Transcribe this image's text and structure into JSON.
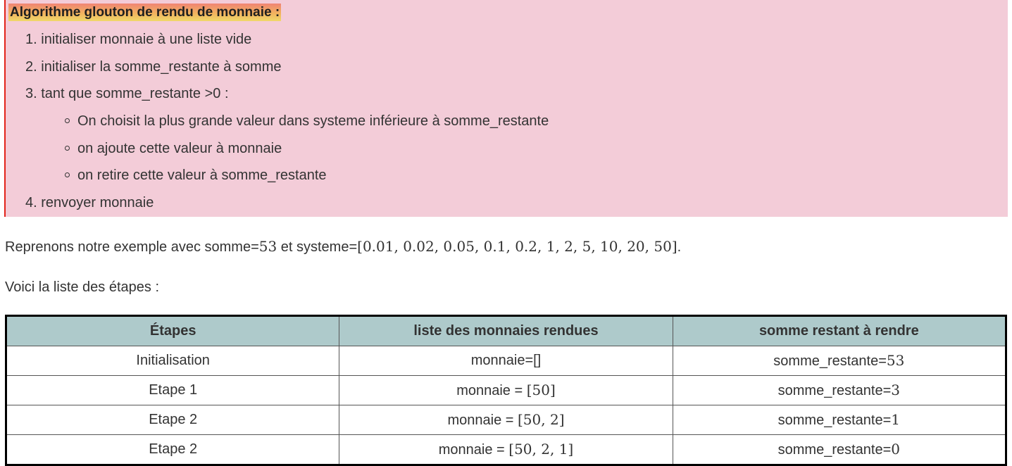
{
  "algorithm": {
    "title": "Algorithme glouton de rendu de monnaie :",
    "steps": [
      {
        "num": "1.",
        "text": "initialiser monnaie à une liste vide"
      },
      {
        "num": "2.",
        "text": "initialiser la somme_restante à somme"
      },
      {
        "num": "3.",
        "text": "tant que somme_restante >0 :"
      },
      {
        "num": "4.",
        "text": "renvoyer monnaie"
      }
    ],
    "substeps": [
      "On choisit la plus grande valeur dans systeme inférieure à somme_restante",
      "on ajoute cette valeur à monnaie",
      "on retire cette valeur à somme_restante"
    ]
  },
  "example": {
    "prefix": "Reprenons notre exemple avec somme=",
    "somme": "53",
    "middle": " et systeme=",
    "systeme": "[0.01, 0.02, 0.05, 0.1, 0.2, 1, 2, 5, 10, 20, 50]",
    "suffix": "."
  },
  "intro": "Voici la liste des étapes :",
  "table": {
    "headers": [
      "Étapes",
      "liste des monnaies rendues",
      "somme restant à rendre"
    ],
    "rows": [
      {
        "etape": "Initialisation",
        "monnaie_label": "monnaie=",
        "monnaie_value": "[]",
        "somme_label": "somme_restante=",
        "somme_value": "53"
      },
      {
        "etape": "Etape 1",
        "monnaie_label": "monnaie = ",
        "monnaie_value": "[50]",
        "somme_label": "somme_restante=",
        "somme_value": "3"
      },
      {
        "etape": "Etape 2",
        "monnaie_label": "monnaie = ",
        "monnaie_value": "[50, 2]",
        "somme_label": "somme_restante=",
        "somme_value": "1"
      },
      {
        "etape": "Etape 2",
        "monnaie_label": "monnaie = ",
        "monnaie_value": "[50, 2, 1]",
        "somme_label": "somme_restante=",
        "somme_value": "0"
      }
    ]
  }
}
